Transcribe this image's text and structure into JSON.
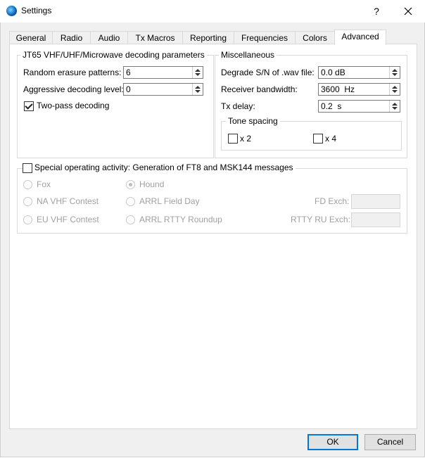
{
  "window": {
    "title": "Settings",
    "help_label": "?",
    "close_label": "✕"
  },
  "tabs": [
    "General",
    "Radio",
    "Audio",
    "Tx Macros",
    "Reporting",
    "Frequencies",
    "Colors",
    "Advanced"
  ],
  "jt65": {
    "title": "JT65 VHF/UHF/Microwave decoding parameters",
    "random_label": "Random erasure patterns:",
    "random_value": "6",
    "aggressive_label": "Aggressive decoding level:",
    "aggressive_value": "0",
    "twopass_label": "Two-pass decoding",
    "twopass_checked": true
  },
  "misc": {
    "title": "Miscellaneous",
    "degrade_label": "Degrade S/N of .wav file:",
    "degrade_value": "0.0 dB",
    "bandwidth_label": "Receiver bandwidth:",
    "bandwidth_value": "3600  Hz",
    "txdelay_label": "Tx delay:",
    "txdelay_value": "0.2  s",
    "tone_title": "Tone spacing",
    "x2_label": "x 2",
    "x4_label": "x 4"
  },
  "special": {
    "title": "Special operating activity:  Generation of FT8 and MSK144 messages",
    "fox": "Fox",
    "hound": "Hound",
    "na_vhf": "NA VHF Contest",
    "field_day": "ARRL Field Day",
    "eu_vhf": "EU VHF Contest",
    "rtty": "ARRL RTTY Roundup",
    "fd_exch": "FD Exch:",
    "rtty_exch": "RTTY RU Exch:"
  },
  "buttons": {
    "ok": "OK",
    "cancel": "Cancel"
  }
}
